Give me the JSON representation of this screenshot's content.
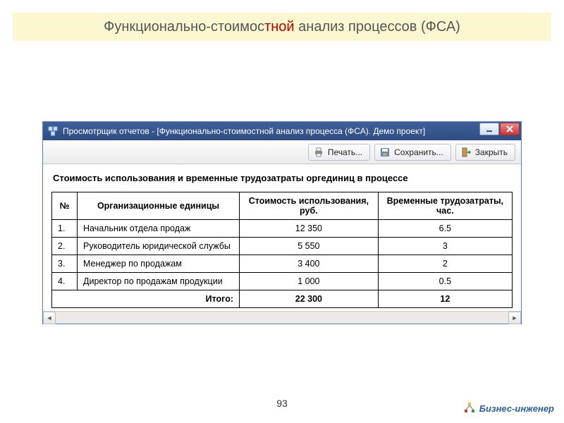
{
  "slide": {
    "title_prefix": "Функционально-стоимос",
    "title_mid": "тной",
    "title_suffix": " анализ процессов (ФСА)",
    "page_number": "93"
  },
  "branding": {
    "label": "Бизнес-инженер"
  },
  "window": {
    "title": "Просмотрщик отчетов -   [Функционально-стоимостной анализ процесса (ФСА). Демо проект]"
  },
  "toolbar": {
    "print_label": "Печать...",
    "save_label": "Сохранить...",
    "close_label": "Закрыть"
  },
  "report": {
    "caption": "Стоимость использования и временные трудозатраты оргединиц в процессе",
    "columns": {
      "n": "№",
      "org": "Организационные единицы",
      "cost": "Стоимость использования, руб.",
      "hours": "Временные трудозатраты, час."
    },
    "rows": [
      {
        "n": "1.",
        "org": "Начальник отдела продаж",
        "cost": "12 350",
        "hours": "6.5"
      },
      {
        "n": "2.",
        "org": "Руководитель юридической службы",
        "cost": "5 550",
        "hours": "3"
      },
      {
        "n": "3.",
        "org": "Менеджер по продажам",
        "cost": "3 400",
        "hours": "2"
      },
      {
        "n": "4.",
        "org": "Директор по продажам продукции",
        "cost": "1 000",
        "hours": "0.5"
      }
    ],
    "total": {
      "label": "Итого:",
      "cost": "22 300",
      "hours": "12"
    }
  }
}
